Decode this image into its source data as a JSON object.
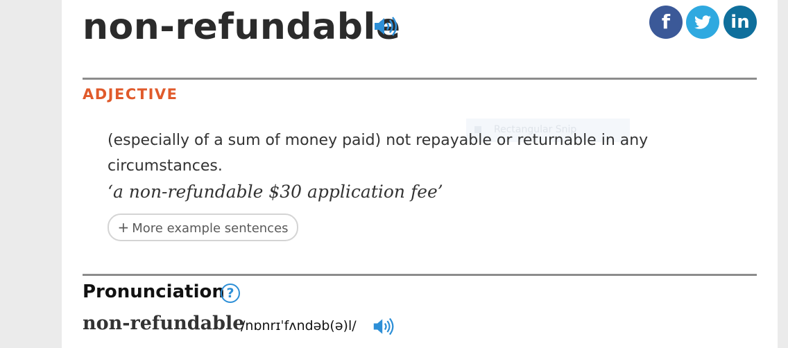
{
  "entry": {
    "headword": "non-refundable",
    "audio_icon": "speaker-icon"
  },
  "share": {
    "facebook_label": "f",
    "twitter_icon": "twitter-bird-icon",
    "linkedin_label": "in",
    "colors": {
      "facebook": "#3b5998",
      "twitter": "#2fa9e0",
      "linkedin": "#0f6f9c"
    }
  },
  "sense": {
    "part_of_speech": "ADJECTIVE",
    "definition": "(especially of a sum of money paid) not repayable or returnable in any circumstances.",
    "example": "‘a non-refundable $30 application fee’",
    "more_examples_plus": "+",
    "more_examples_label": "More example sentences"
  },
  "overlay": {
    "ghost_text": "Rectangular Snip"
  },
  "pronunciation": {
    "heading": "Pronunciation",
    "help_symbol": "?",
    "word": "non-refundable",
    "ipa": "/nɒnrɪˈfʌndəb(ə)l/",
    "audio_icon": "speaker-icon"
  },
  "colors": {
    "accent_orange": "#e05a2b",
    "link_blue": "#2d8fd7",
    "rule_gray": "#8c8c8c"
  }
}
